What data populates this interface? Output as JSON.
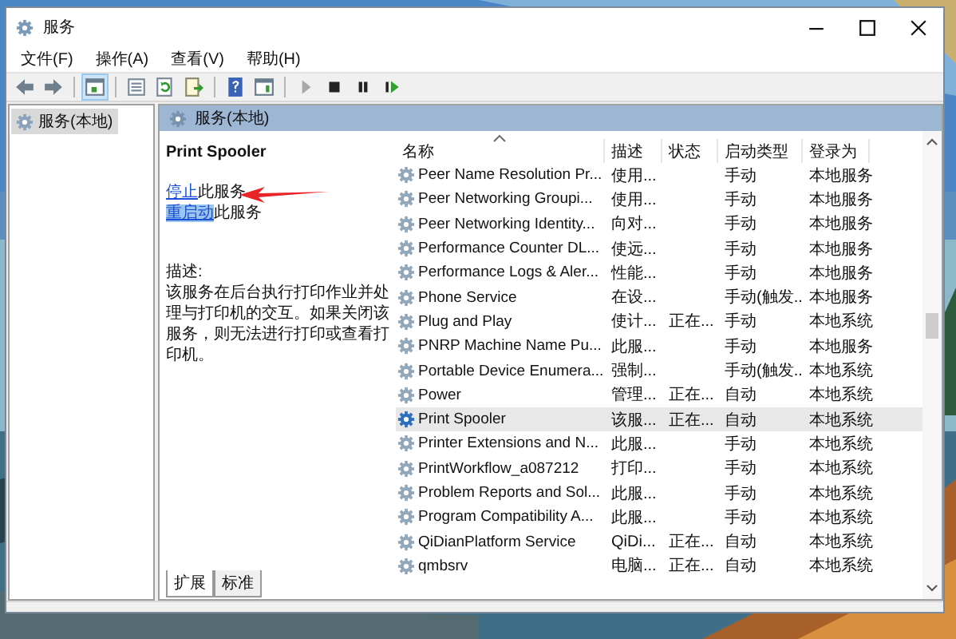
{
  "window": {
    "title": "服务"
  },
  "menu": [
    "文件(F)",
    "操作(A)",
    "查看(V)",
    "帮助(H)"
  ],
  "toolbar": [
    {
      "kind": "back",
      "disabled": false,
      "pressed": false
    },
    {
      "kind": "forward",
      "disabled": false,
      "pressed": false
    },
    {
      "kind": "sep"
    },
    {
      "kind": "tree",
      "disabled": false,
      "pressed": true
    },
    {
      "kind": "sep"
    },
    {
      "kind": "properties",
      "disabled": false,
      "pressed": false
    },
    {
      "kind": "refresh",
      "disabled": false,
      "pressed": false
    },
    {
      "kind": "export",
      "disabled": false,
      "pressed": false
    },
    {
      "kind": "sep"
    },
    {
      "kind": "help",
      "disabled": false,
      "pressed": false
    },
    {
      "kind": "view",
      "disabled": false,
      "pressed": false
    },
    {
      "kind": "sep"
    },
    {
      "kind": "start",
      "disabled": true,
      "pressed": false
    },
    {
      "kind": "stop",
      "disabled": false,
      "pressed": false
    },
    {
      "kind": "pause",
      "disabled": false,
      "pressed": false
    },
    {
      "kind": "resume",
      "disabled": false,
      "pressed": false
    }
  ],
  "tree": {
    "items": [
      {
        "label": "服务(本地)",
        "selected": true
      }
    ]
  },
  "panel": {
    "title": "服务(本地)",
    "service_name": "Print Spooler",
    "actions": [
      {
        "link": "停止",
        "text": "此服务",
        "focused": false
      },
      {
        "link": "重启动",
        "text": "此服务",
        "focused": true
      }
    ],
    "description_label": "描述:",
    "description": "该服务在后台执行打印作业并处理与打印机的交互。如果关闭该服务，则无法进行打印或查看打印机。",
    "tabs": [
      {
        "label": "扩展",
        "selected": true
      },
      {
        "label": "标准",
        "selected": false
      }
    ]
  },
  "table": {
    "columns": [
      {
        "label": "名称",
        "sorted": true
      },
      {
        "label": "描述",
        "sorted": false
      },
      {
        "label": "状态",
        "sorted": false
      },
      {
        "label": "启动类型",
        "sorted": false
      },
      {
        "label": "登录为",
        "sorted": false
      }
    ],
    "rows": [
      {
        "name": "Peer Name Resolution Pr...",
        "description": "使用...",
        "status": "",
        "startup": "手动",
        "logon": "本地服务",
        "selected": false
      },
      {
        "name": "Peer Networking Groupi...",
        "description": "使用...",
        "status": "",
        "startup": "手动",
        "logon": "本地服务",
        "selected": false
      },
      {
        "name": "Peer Networking Identity...",
        "description": "向对...",
        "status": "",
        "startup": "手动",
        "logon": "本地服务",
        "selected": false
      },
      {
        "name": "Performance Counter DL...",
        "description": "使远...",
        "status": "",
        "startup": "手动",
        "logon": "本地服务",
        "selected": false
      },
      {
        "name": "Performance Logs & Aler...",
        "description": "性能...",
        "status": "",
        "startup": "手动",
        "logon": "本地服务",
        "selected": false
      },
      {
        "name": "Phone Service",
        "description": "在设...",
        "status": "",
        "startup": "手动(触发...",
        "logon": "本地服务",
        "selected": false
      },
      {
        "name": "Plug and Play",
        "description": "使计...",
        "status": "正在...",
        "startup": "手动",
        "logon": "本地系统",
        "selected": false
      },
      {
        "name": "PNRP Machine Name Pu...",
        "description": "此服...",
        "status": "",
        "startup": "手动",
        "logon": "本地服务",
        "selected": false
      },
      {
        "name": "Portable Device Enumera...",
        "description": "强制...",
        "status": "",
        "startup": "手动(触发...",
        "logon": "本地系统",
        "selected": false
      },
      {
        "name": "Power",
        "description": "管理...",
        "status": "正在...",
        "startup": "自动",
        "logon": "本地系统",
        "selected": false
      },
      {
        "name": "Print Spooler",
        "description": "该服...",
        "status": "正在...",
        "startup": "自动",
        "logon": "本地系统",
        "selected": true
      },
      {
        "name": "Printer Extensions and N...",
        "description": "此服...",
        "status": "",
        "startup": "手动",
        "logon": "本地系统",
        "selected": false
      },
      {
        "name": "PrintWorkflow_a087212",
        "description": "打印...",
        "status": "",
        "startup": "手动",
        "logon": "本地系统",
        "selected": false
      },
      {
        "name": "Problem Reports and Sol...",
        "description": "此服...",
        "status": "",
        "startup": "手动",
        "logon": "本地系统",
        "selected": false
      },
      {
        "name": "Program Compatibility A...",
        "description": "此服...",
        "status": "",
        "startup": "手动",
        "logon": "本地系统",
        "selected": false
      },
      {
        "name": "QiDianPlatform Service",
        "description": "QiDi...",
        "status": "正在...",
        "startup": "自动",
        "logon": "本地系统",
        "selected": false
      },
      {
        "name": "qmbsrv",
        "description": "电脑...",
        "status": "正在...",
        "startup": "自动",
        "logon": "本地系统",
        "selected": false
      }
    ]
  }
}
